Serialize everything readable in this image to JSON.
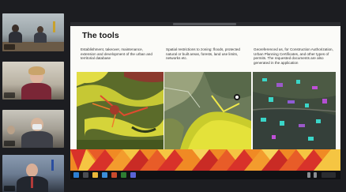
{
  "slide": {
    "title": "The tools",
    "columns": [
      {
        "text": "Establishment, takeover, maintenance, extension and development of the urban and territorial database"
      },
      {
        "text": "Spatial restrictions to zoning: floods, protected natural or built areas, forests, land use limits, networks etc."
      },
      {
        "text": "Georeferenced as, for Construction Authorization, Urban Planning Certificates, and other types of permits. The requested documents are also generated in the application"
      }
    ]
  },
  "participants": [
    {
      "label": ""
    },
    {
      "label": ""
    },
    {
      "label": ""
    },
    {
      "label": ""
    }
  ],
  "colors": {
    "app_background": "#1c1d21",
    "slide_background": "#fbfbf8",
    "accent_red": "#d8322a",
    "accent_orange": "#f08a24",
    "accent_yellow": "#f5c542"
  }
}
